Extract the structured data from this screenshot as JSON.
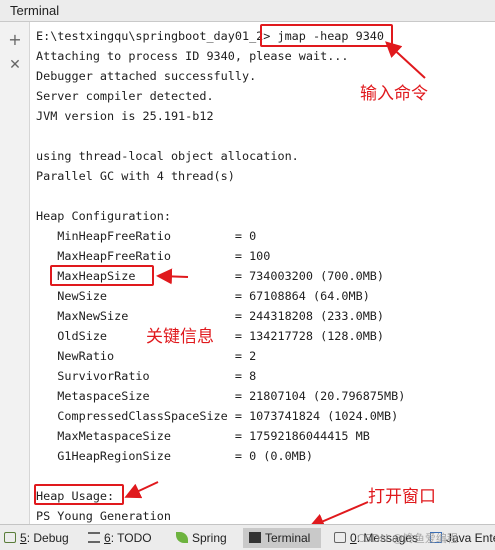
{
  "window": {
    "title": "Terminal"
  },
  "toolbar": {
    "add_symbol": "+",
    "close_symbol": "✕"
  },
  "terminal": {
    "lines": [
      "E:\\testxingqu\\springboot_day01_2> jmap -heap 9340",
      "Attaching to process ID 9340, please wait...",
      "Debugger attached successfully.",
      "Server compiler detected.",
      "JVM version is 25.191-b12",
      "",
      "using thread-local object allocation.",
      "Parallel GC with 4 thread(s)",
      "",
      "Heap Configuration:",
      "   MinHeapFreeRatio         = 0",
      "   MaxHeapFreeRatio         = 100",
      "   MaxHeapSize              = 734003200 (700.0MB)",
      "   NewSize                  = 67108864 (64.0MB)",
      "   MaxNewSize               = 244318208 (233.0MB)",
      "   OldSize                  = 134217728 (128.0MB)",
      "   NewRatio                 = 2",
      "   SurvivorRatio            = 8",
      "   MetaspaceSize            = 21807104 (20.796875MB)",
      "   CompressedClassSpaceSize = 1073741824 (1024.0MB)",
      "   MaxMetaspaceSize         = 17592186044415 MB",
      "   G1HeapRegionSize         = 0 (0.0MB)",
      "",
      "Heap Usage:",
      "PS Young Generation"
    ]
  },
  "annotations": {
    "input_command": "输入命令",
    "key_info": "关键信息",
    "open_window": "打开窗口"
  },
  "statusbar": {
    "tabs": [
      {
        "num": "5",
        "label": ": Debug"
      },
      {
        "num": "6",
        "label": ": TODO"
      },
      {
        "num": "",
        "label": "Spring"
      },
      {
        "num": "",
        "label": "Terminal"
      },
      {
        "num": "0",
        "label": ": Messages"
      },
      {
        "num": "",
        "label": "Java Ente"
      }
    ]
  },
  "watermark": "CSDN @馋鱼爱编程",
  "colors": {
    "annotation_red": "#e0191d",
    "active_tab": "#c9c9c9"
  }
}
